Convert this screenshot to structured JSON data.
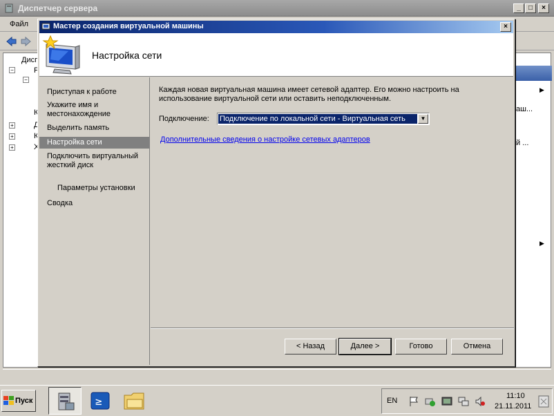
{
  "main_window": {
    "title": "Диспетчер сервера",
    "menu": [
      "Файл"
    ],
    "tree_items": [
      "Дисп",
      "Р",
      "К",
      "Д",
      "К",
      "Х"
    ],
    "right_pane_items": [
      "аш...",
      "й ..."
    ]
  },
  "wizard": {
    "title": "Мастер создания виртуальной машины",
    "header_title": "Настройка сети",
    "nav_items": [
      {
        "label": "Приступая к работе"
      },
      {
        "label": "Укажите имя и местонахождение"
      },
      {
        "label": "Выделить память"
      },
      {
        "label": "Настройка сети",
        "selected": true
      },
      {
        "label": "Подключить виртуальный жесткий диск"
      },
      {
        "label": "Параметры установки",
        "indent": true
      },
      {
        "label": "Сводка"
      }
    ],
    "description": "Каждая новая виртуальная машина имеет сетевой адаптер. Его можно настроить на использование виртуальной сети или оставить неподключенным.",
    "connection_label": "Подключение:",
    "connection_value": "Подключение по локальной сети - Виртуальная сеть",
    "more_info_link": "Дополнительные сведения о настройке сетевых адаптеров",
    "buttons": {
      "back": "< Назад",
      "next": "Далее >",
      "finish": "Готово",
      "cancel": "Отмена"
    }
  },
  "taskbar": {
    "start_label": "Пуск",
    "language": "EN",
    "time": "11:10",
    "date": "21.11.2011"
  },
  "colors": {
    "title_active": "#0a246a",
    "selection": "#0a246a",
    "link": "#0000ee"
  }
}
